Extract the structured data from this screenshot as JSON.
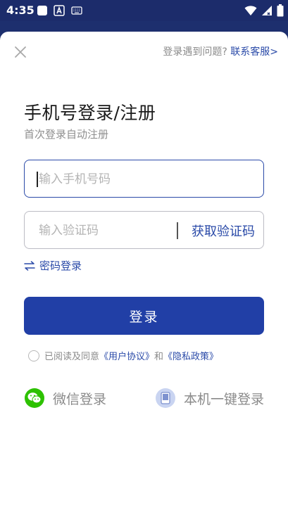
{
  "status_bar": {
    "time": "4:35"
  },
  "header": {
    "help_text": "登录遇到问题?",
    "contact_link": "联系客服>"
  },
  "title": "手机号登录/注册",
  "subtitle": "首次登录自动注册",
  "phone_field": {
    "placeholder": "输入手机号码",
    "value": ""
  },
  "code_field": {
    "placeholder": "输入验证码",
    "value": "",
    "get_code_label": "获取验证码"
  },
  "password_login_label": "密码登录",
  "login_button_label": "登录",
  "agreement": {
    "prefix": "已阅读及同意",
    "user_agreement": "《用户协议》",
    "and": "和",
    "privacy_policy": "《隐私政策》",
    "checked": false
  },
  "alt_logins": {
    "wechat": "微信登录",
    "one_click": "本机一键登录"
  },
  "colors": {
    "accent": "#213fa6",
    "link": "#2a4aa8",
    "status_bar": "#1c2c6b",
    "wechat_green": "#2dc100"
  }
}
